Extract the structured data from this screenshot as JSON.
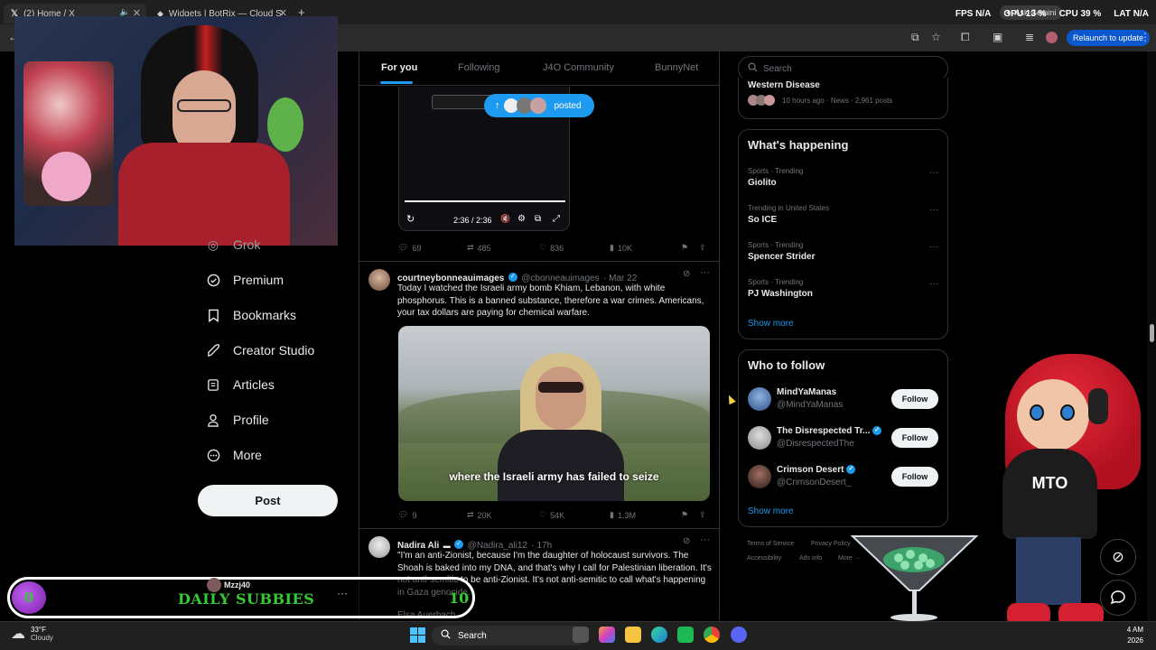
{
  "browser": {
    "tabs": [
      {
        "label": "(2) Home / X",
        "active": true
      },
      {
        "label": "Widgets | BotRix — Cloud Stre",
        "active": false
      }
    ],
    "relaunch_label": "Relaunch to update",
    "gemini_label": "Ask Gemini"
  },
  "perf": {
    "fps_label": "FPS",
    "fps_value": "N/A",
    "gpu_label": "GPU",
    "gpu_value": "13 %",
    "cpu_label": "CPU",
    "cpu_value": "39 %",
    "lat_label": "LAT",
    "lat_value": "N/A"
  },
  "nav": {
    "items": [
      {
        "label": "Grok",
        "icon": "grok-icon"
      },
      {
        "label": "Premium",
        "icon": "premium-icon"
      },
      {
        "label": "Bookmarks",
        "icon": "bookmark-icon"
      },
      {
        "label": "Creator Studio",
        "icon": "rocket-icon"
      },
      {
        "label": "Articles",
        "icon": "article-icon"
      },
      {
        "label": "Profile",
        "icon": "profile-icon"
      },
      {
        "label": "More",
        "icon": "more-icon"
      }
    ],
    "post_label": "Post"
  },
  "feed": {
    "tabs": [
      "For you",
      "Following",
      "J4O Community",
      "BunnyNet"
    ],
    "posted_pill": "posted",
    "video_time": "2:36 / 2:36",
    "tweet1_metrics": {
      "replies": "69",
      "reposts": "485",
      "likes": "836",
      "views": "10K"
    },
    "tweet2": {
      "name": "courtneybonneauimages",
      "handle": "@cbonneauimages",
      "date": "· Mar 22",
      "text": "Today I watched the Israeli army bomb Khiam, Lebanon, with white phosphorus. This is a banned substance, therefore a war crimes. Americans, your tax dollars are paying for chemical warfare.",
      "caption": "where the Israeli army has failed to seize",
      "metrics": {
        "replies": "9",
        "reposts": "20K",
        "likes": "54K",
        "views": "1.3M"
      }
    },
    "tweet3": {
      "name": "Nadira Ali",
      "handle": "@Nadira_ali12",
      "date": "· 17h",
      "text": "\"I'm an anti-Zionist, because I'm the daughter of holocaust survivors. The Shoah is baked into my DNA, and that's why I call for Palestinian liberation. It's not anti-semitic to be anti-Zionist. It's not anti-semitic to call what's happening in Gaza genocide.\"",
      "attribution": "Elsa Auerbach"
    }
  },
  "right": {
    "search_placeholder": "Search",
    "news_title": "Western Disease",
    "news_meta": "10 hours ago · News · 2,961 posts",
    "whats_happening": "What's happening",
    "trends": [
      {
        "context": "Sports · Trending",
        "name": "Giolito"
      },
      {
        "context": "Trending in United States",
        "name": "So ICE"
      },
      {
        "context": "Sports · Trending",
        "name": "Spencer Strider"
      },
      {
        "context": "Sports · Trending",
        "name": "PJ Washington"
      }
    ],
    "show_more": "Show more",
    "who_to_follow": "Who to follow",
    "follow_suggestions": [
      {
        "name": "MindYaManas",
        "handle": "@MindYaManas",
        "verified": false
      },
      {
        "name": "The Disrespected Tr...",
        "handle": "@DisrespectedThe",
        "verified": true
      },
      {
        "name": "Crimson Desert",
        "handle": "@CrimsonDesert_",
        "verified": true
      }
    ],
    "follow_label": "Follow",
    "footer": [
      "Terms of Service",
      "Privacy Policy",
      "Accessibility",
      "Ads info",
      "More ···"
    ]
  },
  "overlay": {
    "subbies_left": "0",
    "subbies_label": "DAILY SUBBIES",
    "subbies_right": "10",
    "subbies_user": "Mzzj40",
    "avatar_label": "MTO"
  },
  "taskbar": {
    "weather_temp": "33°F",
    "weather_desc": "Cloudy",
    "search_label": "Search",
    "time": "4 AM",
    "date": "2026"
  },
  "colors": {
    "accent": "#1d9bf0",
    "background": "#000000",
    "subbies_green": "#33cc33",
    "subbies_purple": "#9b30d0"
  }
}
